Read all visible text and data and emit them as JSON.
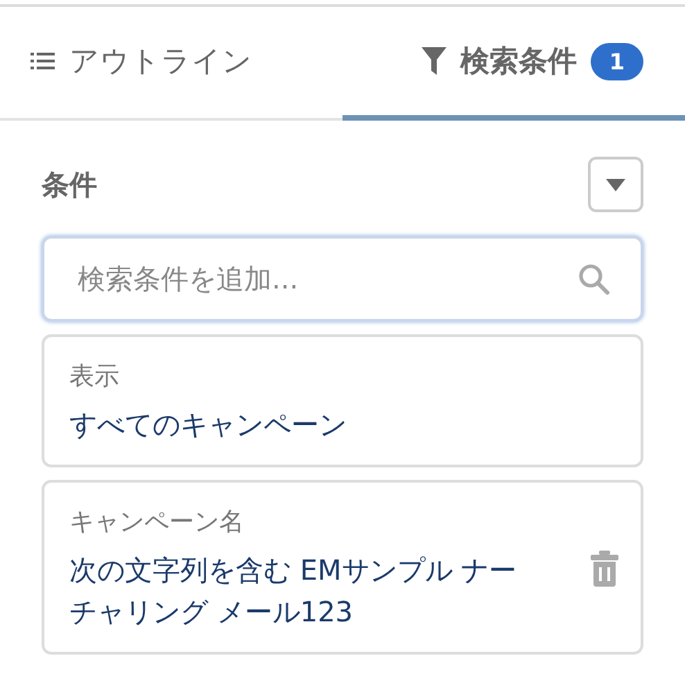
{
  "tabs": [
    {
      "label": "アウトライン",
      "kind": "outline",
      "selected": false
    },
    {
      "label": "検索条件",
      "kind": "filter",
      "badge": "1",
      "selected": true
    }
  ],
  "section": {
    "title": "条件"
  },
  "search": {
    "placeholder": "検索条件を追加..."
  },
  "conditions": [
    {
      "label": "表示",
      "value": "すべてのキャンペーン",
      "deletable": false
    },
    {
      "label": "キャンペーン名",
      "value": "次の文字列を含む EMサンプル ナーチャリング メール123",
      "deletable": true
    }
  ]
}
